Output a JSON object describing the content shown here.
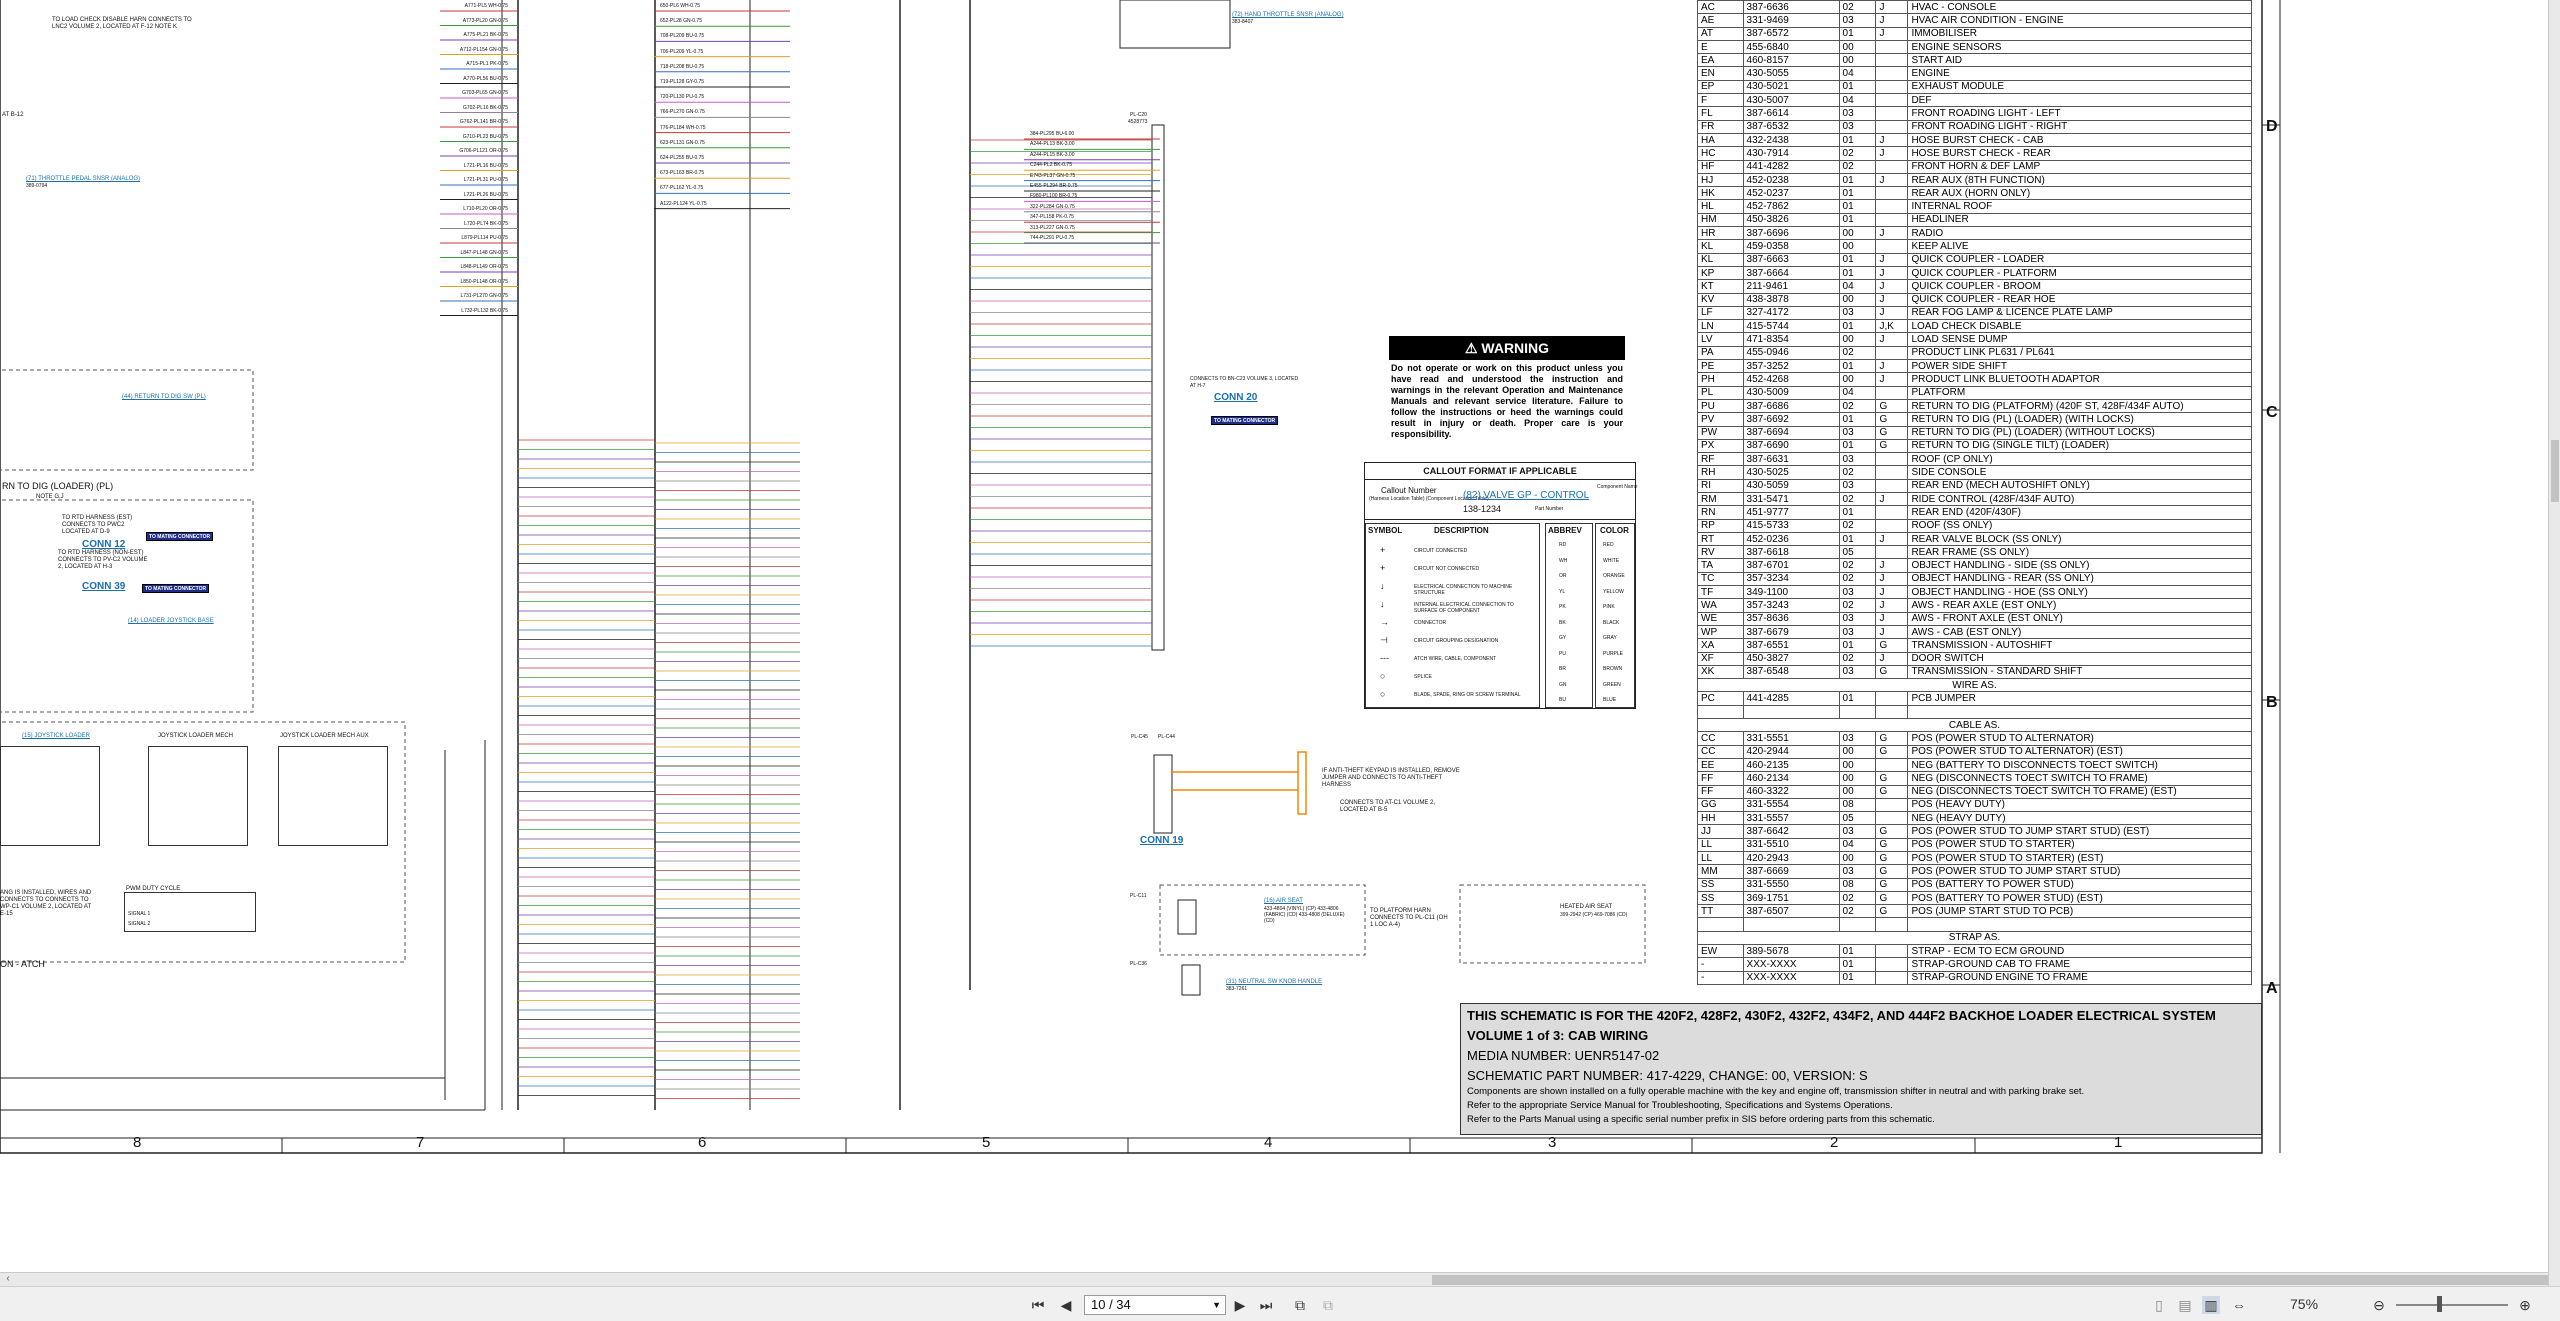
{
  "zones": [
    "D",
    "C",
    "B",
    "A"
  ],
  "columns": [
    "8",
    "7",
    "6",
    "5",
    "4",
    "3",
    "2",
    "1"
  ],
  "left_notes": {
    "lockcheck": "TO LOAD CHECK DISABLE HARN CONNECTS TO LNC2 VOLUME 2, LOCATED AT F-12 NOTE K",
    "at_b12": "AT B-12",
    "throttle_pedal": "(71) THROTTLE PEDAL SNSR (ANALOG)",
    "throttle_pedal_pn": "389-0794",
    "return_dig_sw": "(44) RETURN TO DIG SW (PL)",
    "return_dig_title": "RN TO DIG (LOADER) (PL)",
    "note_gj": "NOTE G,J",
    "rtd_harness": "TO RTD HARNESS (EST) CONNECTS TO PWC2 LOCATED AT D-9",
    "conn12": "CONN 12",
    "rtd_harness2": "TO RTD HARNESS (NON-EST) CONNECTS TO PV-C2 VOLUME 2, LOCATED AT H-3",
    "conn39": "CONN 39",
    "loader_joystick": "(14) LOADER JOYSTICK BASE",
    "joystick_loader": "(15) JOYSTICK LOADER",
    "joystick_loader_mech": "JOYSTICK LOADER MECH",
    "joystick_loader_mech_aux": "JOYSTICK LOADER MECH AUX",
    "pwm_duty": "PWM DUTY CYCLE",
    "pwm_sig1": "SIGNAL 1",
    "pwm_sig2": "SIGNAL 2",
    "atch": "ON - ATCH",
    "installed_note": "ANG IS INSTALLED, WIRES AND CONNECTS TO CONNECTS TO WP-C1 VOLUME 2, LOCATED AT E-15",
    "to_mating_connector": "TO MATING CONNECTOR"
  },
  "center_notes": {
    "hand_throttle": "(72) HAND THROTTLE SNSR (ANALOG)",
    "hand_throttle_pn": "383-8407",
    "plc20": "PL-C20",
    "plc20_pn": "4528773",
    "conn_bn_c23": "CONNECTS TO BN-C23 VOLUME 3, LOCATED AT H-7",
    "conn20": "CONN 20",
    "conn19": "CONN 19",
    "plc45": "PL-C45",
    "plc44": "PL-C44",
    "antitheft": "IF ANTI-THEFT KEYPAD IS INSTALLED, REMOVE JUMPER AND CONNECTS TO ANTI-THEFT HARNESS",
    "connects_atc1": "CONNECTS TO AT-C1 VOLUME 2, LOCATED AT B-5",
    "air_seat": "(16) AIR SEAT",
    "air_seat_pn": "433-4804 (VINYL) (CP) 433-4806 (FABRIC) (CD) 433-4808 (DELUXE) (CD)",
    "platform_harn": "TO PLATFORM HARN CONNECTS TO PL-C11 (OH 1 LOC A-4)",
    "heated_seat": "HEATED AIR SEAT",
    "heated_seat_pn": "399-2942 (CP) 469-7086 (CD)",
    "neutral_sw": "(31) NEUTRAL SW KNOB HANDLE",
    "neutral_sw_pn": "383-7261",
    "plc11": "PL-C11",
    "plc36": "PL-C36"
  },
  "warning": {
    "title": "WARNING",
    "body": "Do not operate or work on this product unless you have read and understood the instruction and warnings in the relevant Operation and Maintenance Manuals and relevant service literature. Failure to follow the instructions or heed the warnings could result in injury or death. Proper care is your responsibility."
  },
  "callout": {
    "title": "CALLOUT FORMAT IF APPLICABLE",
    "callout_number": "Callout Number",
    "callout_sub": "(Harness Location Table) (Component Location Table)",
    "example_link": "(82) VALVE GP - CONTROL",
    "example_pn": "138-1234",
    "component_name": "Component Name",
    "part_number": "Part Number",
    "symbol_head": "SYMBOL",
    "description_head": "DESCRIPTION",
    "abbrev_head": "ABBREV",
    "color_head": "COLOR",
    "symbols": [
      {
        "sym": "+",
        "desc": "CIRCUIT CONNECTED"
      },
      {
        "sym": "+",
        "desc": "CIRCUIT NOT CONNECTED"
      },
      {
        "sym": "↓",
        "desc": "ELECTRICAL CONNECTION TO MACHINE STRUCTURE"
      },
      {
        "sym": "↓",
        "desc": "INTERNAL ELECTRICAL CONNECTION TO SURFACE OF COMPONENT"
      },
      {
        "sym": "→",
        "desc": "CONNECTOR"
      },
      {
        "sym": "⊣",
        "desc": "CIRCUIT GROUPING DESIGNATION"
      },
      {
        "sym": "---",
        "desc": "ATCH WIRE, CABLE, COMPONENT"
      },
      {
        "sym": "○",
        "desc": "SPLICE"
      },
      {
        "sym": "○",
        "desc": "BLADE, SPADE, RING OR SCREW TERMINAL"
      }
    ],
    "colors": [
      {
        "abbr": "RD",
        "name": "RED"
      },
      {
        "abbr": "WH",
        "name": "WHITE"
      },
      {
        "abbr": "OR",
        "name": "ORANGE"
      },
      {
        "abbr": "YL",
        "name": "YELLOW"
      },
      {
        "abbr": "PK",
        "name": "PINK"
      },
      {
        "abbr": "BK",
        "name": "BLACK"
      },
      {
        "abbr": "GY",
        "name": "GRAY"
      },
      {
        "abbr": "PU",
        "name": "PURPLE"
      },
      {
        "abbr": "BR",
        "name": "BROWN"
      },
      {
        "abbr": "GN",
        "name": "GREEN"
      },
      {
        "abbr": "BU",
        "name": "BLUE"
      }
    ]
  },
  "code_table": [
    [
      "AC",
      "387-6636",
      "02",
      "J",
      "HVAC - CONSOLE"
    ],
    [
      "AE",
      "331-9469",
      "03",
      "J",
      "HVAC AIR CONDITION - ENGINE"
    ],
    [
      "AT",
      "387-6572",
      "01",
      "J",
      "IMMOBILISER"
    ],
    [
      "E",
      "455-6840",
      "00",
      "",
      "ENGINE SENSORS"
    ],
    [
      "EA",
      "460-8157",
      "00",
      "",
      "START AID"
    ],
    [
      "EN",
      "430-5055",
      "04",
      "",
      "ENGINE"
    ],
    [
      "EP",
      "430-5021",
      "01",
      "",
      "EXHAUST MODULE"
    ],
    [
      "F",
      "430-5007",
      "04",
      "",
      "DEF"
    ],
    [
      "FL",
      "387-6614",
      "03",
      "",
      "FRONT ROADING LIGHT - LEFT"
    ],
    [
      "FR",
      "387-6532",
      "03",
      "",
      "FRONT ROADING LIGHT - RIGHT"
    ],
    [
      "HA",
      "432-2438",
      "01",
      "J",
      "HOSE BURST CHECK - CAB"
    ],
    [
      "HC",
      "430-7914",
      "02",
      "J",
      "HOSE BURST CHECK - REAR"
    ],
    [
      "HF",
      "441-4282",
      "02",
      "",
      "FRONT HORN & DEF LAMP"
    ],
    [
      "HJ",
      "452-0238",
      "01",
      "J",
      "REAR AUX (8TH FUNCTION)"
    ],
    [
      "HK",
      "452-0237",
      "01",
      "",
      "REAR AUX (HORN ONLY)"
    ],
    [
      "HL",
      "452-7862",
      "01",
      "",
      "INTERNAL ROOF"
    ],
    [
      "HM",
      "450-3826",
      "01",
      "",
      "HEADLINER"
    ],
    [
      "HR",
      "387-6696",
      "00",
      "J",
      "RADIO"
    ],
    [
      "KL",
      "459-0358",
      "00",
      "",
      "KEEP ALIVE"
    ],
    [
      "KL",
      "387-6663",
      "01",
      "J",
      "QUICK COUPLER - LOADER"
    ],
    [
      "KP",
      "387-6664",
      "01",
      "J",
      "QUICK COUPLER - PLATFORM"
    ],
    [
      "KT",
      "211-9461",
      "04",
      "J",
      "QUICK COUPLER - BROOM"
    ],
    [
      "KV",
      "438-3878",
      "00",
      "J",
      "QUICK COUPLER - REAR HOE"
    ],
    [
      "LF",
      "327-4172",
      "03",
      "J",
      "REAR FOG LAMP & LICENCE PLATE LAMP"
    ],
    [
      "LN",
      "415-5744",
      "01",
      "J,K",
      "LOAD CHECK DISABLE"
    ],
    [
      "LV",
      "471-8354",
      "00",
      "J",
      "LOAD SENSE DUMP"
    ],
    [
      "PA",
      "455-0946",
      "02",
      "",
      "PRODUCT LINK PL631 / PL641"
    ],
    [
      "PE",
      "357-3252",
      "01",
      "J",
      "POWER SIDE SHIFT"
    ],
    [
      "PH",
      "452-4268",
      "00",
      "J",
      "PRODUCT LINK BLUETOOTH ADAPTOR"
    ],
    [
      "PL",
      "430-5009",
      "04",
      "",
      "PLATFORM"
    ],
    [
      "PU",
      "387-6686",
      "02",
      "G",
      "RETURN TO DIG (PLATFORM) (420F ST, 428F/434F AUTO)"
    ],
    [
      "PV",
      "387-6692",
      "01",
      "G",
      "RETURN TO DIG (PL) (LOADER) (WITH LOCKS)"
    ],
    [
      "PW",
      "387-6694",
      "03",
      "G",
      "RETURN TO DIG (PL) (LOADER) (WITHOUT LOCKS)"
    ],
    [
      "PX",
      "387-6690",
      "01",
      "G",
      "RETURN TO DIG (SINGLE TILT) (LOADER)"
    ],
    [
      "RF",
      "387-6631",
      "03",
      "",
      "ROOF (CP ONLY)"
    ],
    [
      "RH",
      "430-5025",
      "02",
      "",
      "SIDE CONSOLE"
    ],
    [
      "RI",
      "430-5059",
      "03",
      "",
      "REAR END (MECH AUTOSHIFT ONLY)"
    ],
    [
      "RM",
      "331-5471",
      "02",
      "J",
      "RIDE CONTROL (428F/434F AUTO)"
    ],
    [
      "RN",
      "451-9777",
      "01",
      "",
      "REAR END (420F/430F)"
    ],
    [
      "RP",
      "415-5733",
      "02",
      "",
      "ROOF (SS ONLY)"
    ],
    [
      "RT",
      "452-0236",
      "01",
      "J",
      "REAR VALVE BLOCK (SS ONLY)"
    ],
    [
      "RV",
      "387-6618",
      "05",
      "",
      "REAR FRAME (SS ONLY)"
    ],
    [
      "TA",
      "387-6701",
      "02",
      "J",
      "OBJECT HANDLING - SIDE (SS ONLY)"
    ],
    [
      "TC",
      "357-3234",
      "02",
      "J",
      "OBJECT HANDLING - REAR (SS ONLY)"
    ],
    [
      "TF",
      "349-1100",
      "03",
      "J",
      "OBJECT HANDLING - HOE (SS ONLY)"
    ],
    [
      "WA",
      "357-3243",
      "02",
      "J",
      "AWS - REAR AXLE (EST ONLY)"
    ],
    [
      "WE",
      "357-8636",
      "03",
      "J",
      "AWS - FRONT AXLE (EST ONLY)"
    ],
    [
      "WP",
      "387-6679",
      "03",
      "J",
      "AWS - CAB (EST ONLY)"
    ],
    [
      "XA",
      "387-6551",
      "01",
      "G",
      "TRANSMISSION - AUTOSHIFT"
    ],
    [
      "XF",
      "450-3827",
      "02",
      "J",
      "DOOR SWITCH"
    ],
    [
      "XK",
      "387-6548",
      "03",
      "G",
      "TRANSMISSION - STANDARD SHIFT"
    ],
    [
      "",
      "",
      "",
      "",
      "WIRE AS."
    ],
    [
      "PC",
      "441-4285",
      "01",
      "",
      "PCB JUMPER"
    ],
    [
      "",
      "",
      "",
      "",
      ""
    ],
    [
      "",
      "",
      "",
      "",
      "CABLE AS."
    ],
    [
      "CC",
      "331-5551",
      "03",
      "G",
      "POS (POWER STUD TO ALTERNATOR)"
    ],
    [
      "CC",
      "420-2944",
      "00",
      "G",
      "POS (POWER STUD TO ALTERNATOR) (EST)"
    ],
    [
      "EE",
      "460-2135",
      "00",
      "",
      "NEG (BATTERY TO DISCONNECTS TOECT SWITCH)"
    ],
    [
      "FF",
      "460-2134",
      "00",
      "G",
      "NEG (DISCONNECTS TOECT SWITCH TO FRAME)"
    ],
    [
      "FF",
      "460-3322",
      "00",
      "G",
      "NEG (DISCONNECTS TOECT SWITCH TO FRAME) (EST)"
    ],
    [
      "GG",
      "331-5554",
      "08",
      "",
      "POS (HEAVY DUTY)"
    ],
    [
      "HH",
      "331-5557",
      "05",
      "",
      "NEG (HEAVY DUTY)"
    ],
    [
      "JJ",
      "387-6642",
      "03",
      "G",
      "POS (POWER STUD TO JUMP START STUD) (EST)"
    ],
    [
      "LL",
      "331-5510",
      "04",
      "G",
      "POS (POWER STUD TO STARTER)"
    ],
    [
      "LL",
      "420-2943",
      "00",
      "G",
      "POS (POWER STUD TO STARTER) (EST)"
    ],
    [
      "MM",
      "387-6669",
      "03",
      "G",
      "POS (POWER STUD TO JUMP START STUD)"
    ],
    [
      "SS",
      "331-5550",
      "08",
      "G",
      "POS (BATTERY TO POWER STUD)"
    ],
    [
      "SS",
      "369-1751",
      "02",
      "G",
      "POS (BATTERY TO POWER STUD) (EST)"
    ],
    [
      "TT",
      "387-6507",
      "02",
      "G",
      "POS (JUMP START STUD TO PCB)"
    ],
    [
      "",
      "",
      "",
      "",
      ""
    ],
    [
      "",
      "",
      "",
      "",
      "STRAP AS."
    ],
    [
      "EW",
      "389-5678",
      "01",
      "",
      "STRAP - ECM TO ECM GROUND"
    ],
    [
      "-",
      "XXX-XXXX",
      "01",
      "",
      "STRAP-GROUND CAB TO FRAME"
    ],
    [
      "-",
      "XXX-XXXX",
      "01",
      "",
      "STRAP-GROUND ENGINE TO FRAME"
    ]
  ],
  "title_block": {
    "line1": "THIS SCHEMATIC IS FOR THE 420F2, 428F2, 430F2, 432F2, 434F2, AND 444F2 BACKHOE LOADER ELECTRICAL SYSTEM",
    "line2": "VOLUME 1 of 3: CAB WIRING",
    "line3": "MEDIA NUMBER: UENR5147-02",
    "line4": "SCHEMATIC PART NUMBER: 417-4229, CHANGE: 00, VERSION: S",
    "line5": "Components are shown installed on a fully operable machine with the key and engine off, transmission shifter in neutral and with parking brake set.",
    "line6": "Refer to the appropriate Service Manual for Troubleshooting, Specifications and Systems Operations.",
    "line7": "Refer to the Parts Manual using a specific serial number prefix in SIS before ordering parts from this schematic."
  },
  "wire_labels_col1": [
    "A771-PL5 WH-0.75",
    "A773-PL20 GN-0.75",
    "A775-PL21 BK-0.75",
    "A712-PL154 GN-0.75",
    "A715-PL1 PK-0.75",
    "A770-PL56 BU-0.75",
    "G703-PL65 GN-0.75",
    "G702-PL16 BK-0.75",
    "G762-PL141 BR-0.75",
    "G710-PL23 BU-0.75",
    "G706-PL121 OR-0.75",
    "L721-PL16 BU-0.75",
    "L721-PL31 PU-0.75",
    "L721-PL26 BU-0.75",
    "L710-PL20 OR-0.75",
    "L720-PL74 BK-0.75",
    "L879-PL114 PU-0.75",
    "L847-PL148 GN-0.75",
    "L848-PL149 OR-0.75",
    "L850-PL148 OR-0.75",
    "L731-PL270 GN-0.75",
    "L732-PL132 BK-0.75"
  ],
  "wire_labels_col2": [
    "650-PL6 WH-0.75",
    "652-PL28 GN-0.75",
    "708-PL209 BU-0.75",
    "706-PL209 YL-0.75",
    "718-PL208 BU-0.75",
    "719-PL128 GY-0.75",
    "720-PL130 PU-0.75",
    "766-PL270 GN-0.75",
    "776-PL184 WH-0.75",
    "623-PL131 GN-0.75",
    "624-PL255 BU-0.75",
    "673-PL163 BR-0.75",
    "677-PL162 YL-0.75",
    "A122-PL124 YL-0.75"
  ],
  "wire_labels_col3": [
    "384-PL295 BU-6.00",
    "A244-PL13 BK-3.00",
    "A244-PL15 BK-3.00",
    "C244-PL2 BK-0.75",
    "E743-PL37 GN-0.75",
    "E455-PL294 BR-0.75",
    "F980-PL100 BR-0.75",
    "322-PL284 GN-0.75",
    "347-PL158 PK-0.75",
    "313-PL227 GN-0.75",
    "744-PL291 PU-0.75"
  ],
  "toolbar": {
    "page_current": "10 / 34",
    "zoom": "75%"
  }
}
